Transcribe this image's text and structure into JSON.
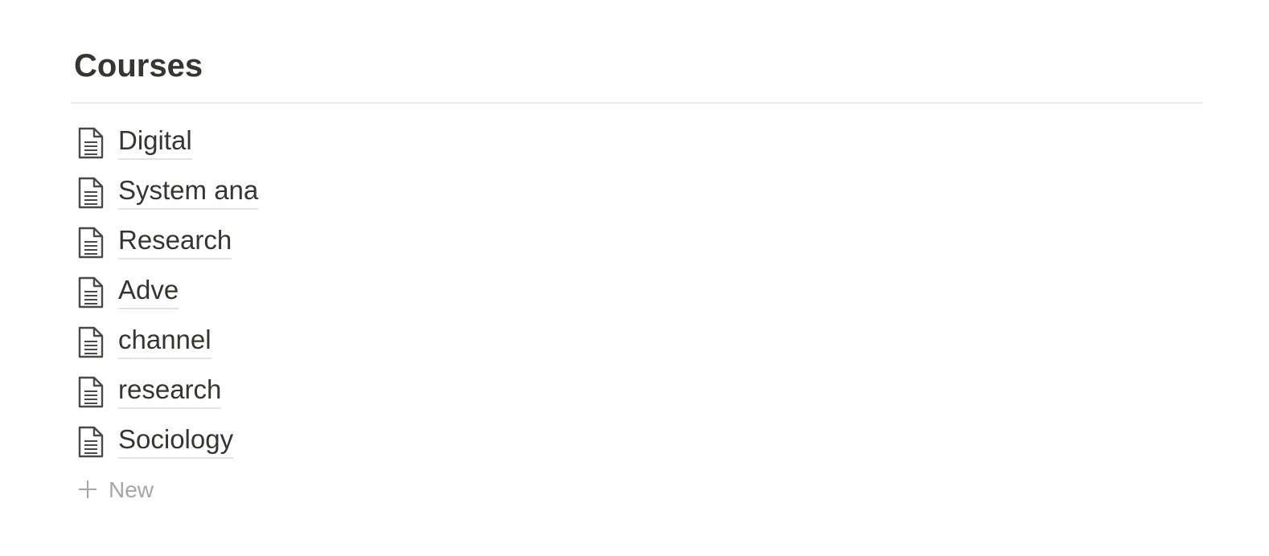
{
  "page": {
    "title": "Courses"
  },
  "courses": [
    {
      "label": "Digital",
      "icon": "page-icon"
    },
    {
      "label": "System ana",
      "icon": "page-icon"
    },
    {
      "label": "Research",
      "icon": "page-icon"
    },
    {
      "label": "Adve",
      "icon": "page-icon"
    },
    {
      "label": "channel",
      "icon": "page-icon"
    },
    {
      "label": "research",
      "icon": "page-icon"
    },
    {
      "label": "Sociology",
      "icon": "page-icon"
    }
  ],
  "new_button": {
    "label": "New",
    "icon": "plus-icon"
  },
  "colors": {
    "text": "#37352f",
    "muted": "#a6a6a3",
    "divider": "#ebeae6",
    "underline": "#e3e2de"
  }
}
